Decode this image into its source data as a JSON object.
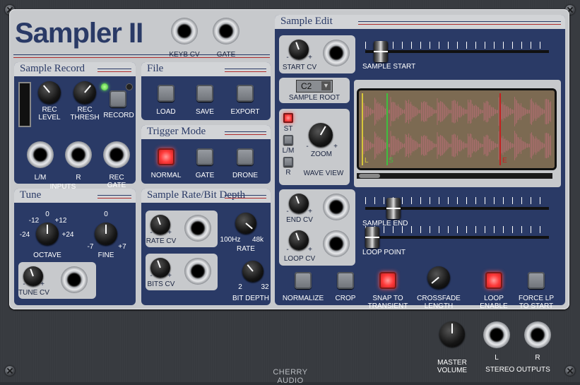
{
  "title": "Sampler II",
  "top_jacks": {
    "keyb_cv": "KEYB CV",
    "gate": "GATE"
  },
  "sample_record": {
    "title": "Sample Record",
    "rec_level": "REC\nLEVEL",
    "rec_thresh": "REC\nTHRESH",
    "record": "RECORD",
    "l_m": "L/M",
    "r": "R",
    "rec_gate": "REC\nGATE",
    "inputs": "INPUTS"
  },
  "file": {
    "title": "File",
    "load": "LOAD",
    "save": "SAVE",
    "export": "EXPORT"
  },
  "trigger_mode": {
    "title": "Trigger Mode",
    "normal": "NORMAL",
    "gate": "GATE",
    "drone": "DRONE"
  },
  "tune": {
    "title": "Tune",
    "oct_m12": "-12",
    "oct_0": "0",
    "oct_p12": "+12",
    "oct_m24": "-24",
    "oct_p24": "+24",
    "octave": "OCTAVE",
    "fine_0": "0",
    "fine_m7": "-7",
    "fine_p7": "+7",
    "fine": "FINE",
    "tune_cv": "TUNE CV",
    "minus": "-",
    "plus": "+"
  },
  "rate_bit": {
    "title": "Sample Rate/Bit Depth",
    "rate_cv": "RATE CV",
    "rate_lo": "100Hz",
    "rate_hi": "48k",
    "rate": "RATE",
    "bits_cv": "BITS CV",
    "bits_lo": "2",
    "bits_hi": "32",
    "bit_depth": "BIT DEPTH"
  },
  "sample_edit": {
    "title": "Sample Edit",
    "start_cv": "START CV",
    "sample_start": "SAMPLE START",
    "root_value": "C2",
    "sample_root": "SAMPLE ROOT",
    "st": "ST",
    "lm": "L/M",
    "r": "R",
    "zoom": "ZOOM",
    "wave_view": "WAVE VIEW",
    "marker_l": "L",
    "marker_s": "S",
    "marker_e": "E",
    "end_cv": "END CV",
    "sample_end": "SAMPLE END",
    "loop_cv": "LOOP CV",
    "loop_point": "LOOP POINT",
    "normalize": "NORMALIZE",
    "crop": "CROP",
    "snap": "SNAP TO\nTRANSIENT",
    "crossfade": "CROSSFADE\nLENGTH",
    "loop_enable": "LOOP\nENABLE",
    "force_lp": "FORCE LP\nTO START"
  },
  "outputs": {
    "master": "MASTER\nVOLUME",
    "l": "L",
    "r": "R",
    "stereo": "STEREO OUTPUTS"
  },
  "brand": "CHERRY AUDIO",
  "state": {
    "trigger_mode": "NORMAL",
    "st_active": true,
    "snap_to_transient": true,
    "loop_enable": true
  },
  "colors": {
    "panel": "#2a3a66",
    "faceplate": "#c7c9cc",
    "active_red": "#ff3a3a",
    "led_green": "#6cff5a"
  }
}
